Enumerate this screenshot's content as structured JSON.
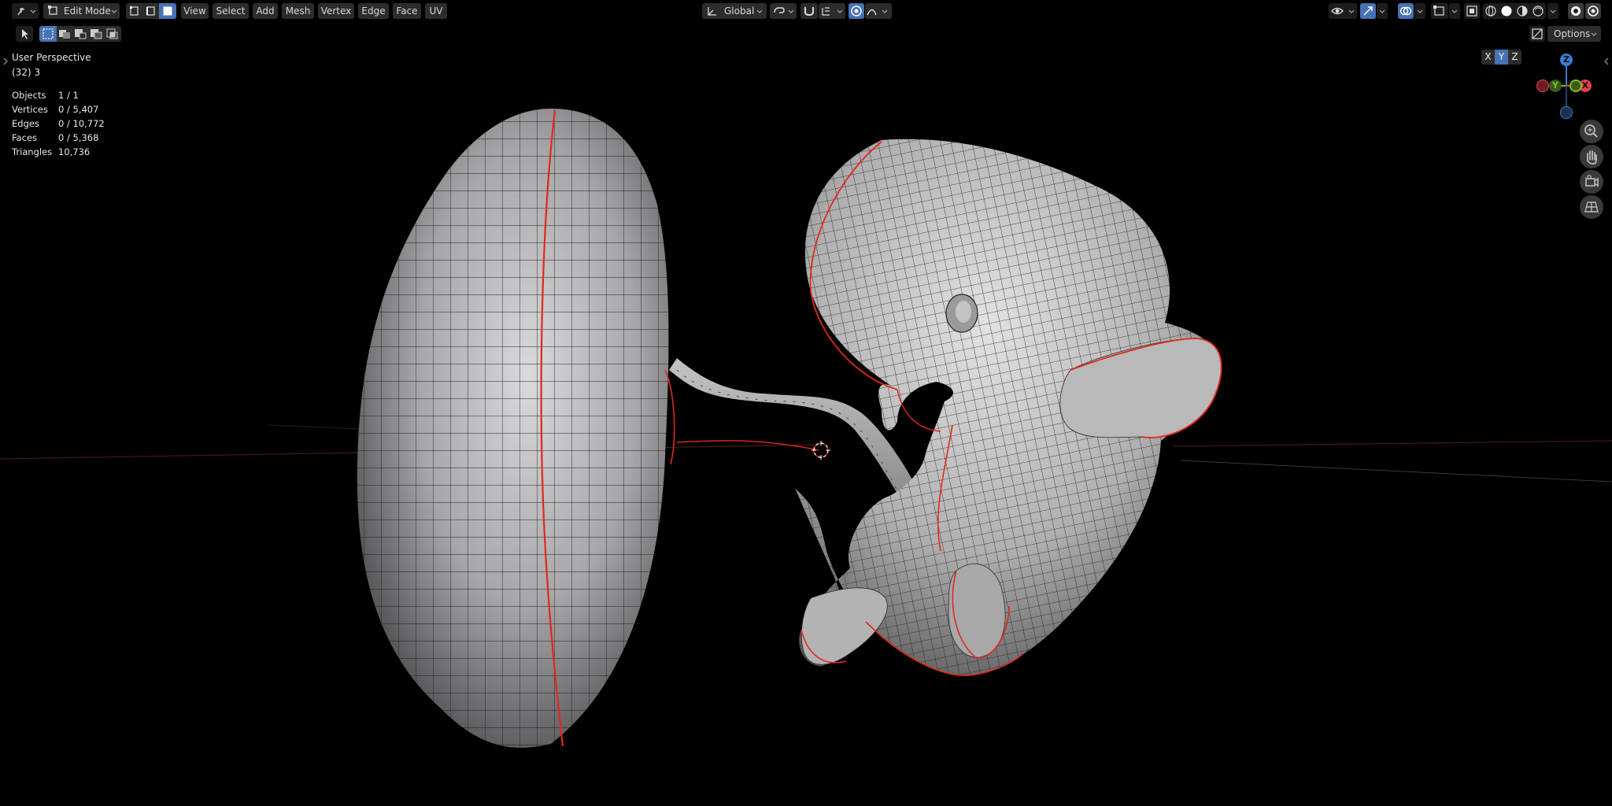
{
  "header": {
    "mode_label": "Edit Mode",
    "menus": [
      "View",
      "Select",
      "Add",
      "Mesh",
      "Vertex",
      "Edge",
      "Face",
      "UV"
    ],
    "transform_orientation": "Global",
    "options_label": "Options",
    "axis_labels": [
      "X",
      "Y",
      "Z"
    ]
  },
  "viewport": {
    "view_name": "User Perspective",
    "collection_info": "(32) 3",
    "stats": [
      {
        "label": "Objects",
        "value": "1 / 1"
      },
      {
        "label": "Vertices",
        "value": "0 / 5,407"
      },
      {
        "label": "Edges",
        "value": "0 / 10,772"
      },
      {
        "label": "Faces",
        "value": "0 / 5,368"
      },
      {
        "label": "Triangles",
        "value": "10,736"
      }
    ]
  },
  "gizmo": {
    "z_label": "Z",
    "y_label": "Y",
    "x_label": "X"
  },
  "colors": {
    "accent": "#4772b3",
    "seam": "#e0281f",
    "mesh_light": "#c8c8c8",
    "mesh_dark": "#3c3c3c",
    "axis_x": "#e3414e",
    "axis_y": "#7fbf2a",
    "axis_z": "#3d7bd1"
  }
}
